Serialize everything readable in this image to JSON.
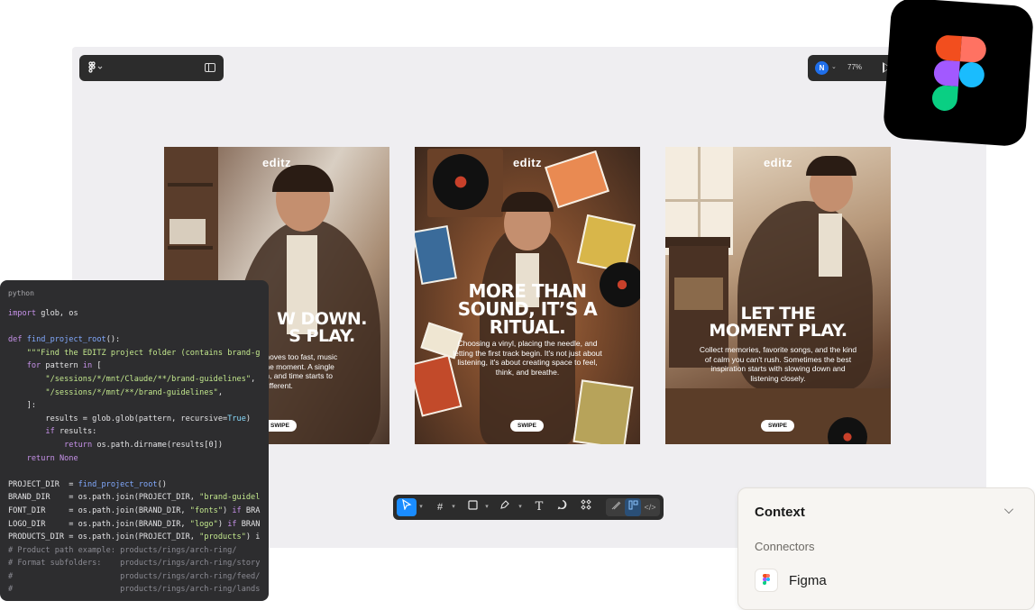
{
  "canvas": {
    "avatar_initial": "N",
    "zoom": "77%"
  },
  "posters": [
    {
      "brand": "editz",
      "headline": "W DOWN.\nS PLAY.",
      "body": "moves too fast, music\nthe moment. A single\nm, and time starts to\ndifferent.",
      "swipe": "SWIPE"
    },
    {
      "brand": "editz",
      "headline": "MORE THAN\nSOUND, IT’S A\nRITUAL.",
      "body": "Choosing a vinyl, placing the needle, and\nletting the first track begin. It's not just about\nlistening, it's about creating space to feel,\nthink, and breathe.",
      "swipe": "SWIPE"
    },
    {
      "brand": "editz",
      "headline": "LET THE\nMOMENT PLAY.",
      "body": "Collect memories, favorite songs, and the kind\nof calm you can't rush. Sometimes the best\ninspiration starts with slowing down and\nlistening closely.",
      "swipe": "SWIPE"
    }
  ],
  "code": {
    "language": "python",
    "lines": [
      {
        "t": "import glob, os",
        "k": "import"
      },
      {
        "t": "",
        "k": "blank"
      },
      {
        "t": "def find_project_root():",
        "k": "def"
      },
      {
        "t": "    \"\"\"Find the EDITZ project folder (contains brand-g",
        "k": "str"
      },
      {
        "t": "    for pattern in [",
        "k": "plain"
      },
      {
        "t": "        \"/sessions/*/mnt/Claude/**/brand-guidelines\",",
        "k": "str"
      },
      {
        "t": "        \"/sessions/*/mnt/**/brand-guidelines\",",
        "k": "str"
      },
      {
        "t": "    ]:",
        "k": "plain"
      },
      {
        "t": "        results = glob.glob(pattern, recursive=True)",
        "k": "plain"
      },
      {
        "t": "        if results:",
        "k": "plain"
      },
      {
        "t": "            return os.path.dirname(results[0])",
        "k": "plain"
      },
      {
        "t": "    return None",
        "k": "plain"
      },
      {
        "t": "",
        "k": "blank"
      },
      {
        "t": "PROJECT_DIR  = find_project_root()",
        "k": "plain"
      },
      {
        "t": "BRAND_DIR    = os.path.join(PROJECT_DIR, \"brand-guidel",
        "k": "plain"
      },
      {
        "t": "FONT_DIR     = os.path.join(BRAND_DIR, \"fonts\") if BRA",
        "k": "plain"
      },
      {
        "t": "LOGO_DIR     = os.path.join(BRAND_DIR, \"logo\") if BRAN",
        "k": "plain"
      },
      {
        "t": "PRODUCTS_DIR = os.path.join(PROJECT_DIR, \"products\") i",
        "k": "plain"
      },
      {
        "t": "# Product path example: products/rings/arch-ring/",
        "k": "comment"
      },
      {
        "t": "# Format subfolders:    products/rings/arch-ring/story",
        "k": "comment"
      },
      {
        "t": "#                       products/rings/arch-ring/feed/",
        "k": "comment"
      },
      {
        "t": "#                       products/rings/arch-ring/lands",
        "k": "comment"
      }
    ]
  },
  "context": {
    "title": "Context",
    "section": "Connectors",
    "connector": "Figma"
  },
  "colors": {
    "accent": "#1a8cff",
    "figma_red": "#f24e1e",
    "figma_orange": "#ff7262",
    "figma_purple": "#a259ff",
    "figma_blue": "#1abcfe",
    "figma_green": "#0acf83"
  },
  "icons": [
    "figma-logo-icon",
    "panel-toggle-icon",
    "play-icon",
    "move-tool-icon",
    "frame-tool-icon",
    "rectangle-tool-icon",
    "pen-tool-icon",
    "text-tool-icon",
    "comment-tool-icon",
    "components-icon",
    "draw-mode-icon",
    "design-mode-icon",
    "dev-mode-icon",
    "chevron-down-icon"
  ]
}
